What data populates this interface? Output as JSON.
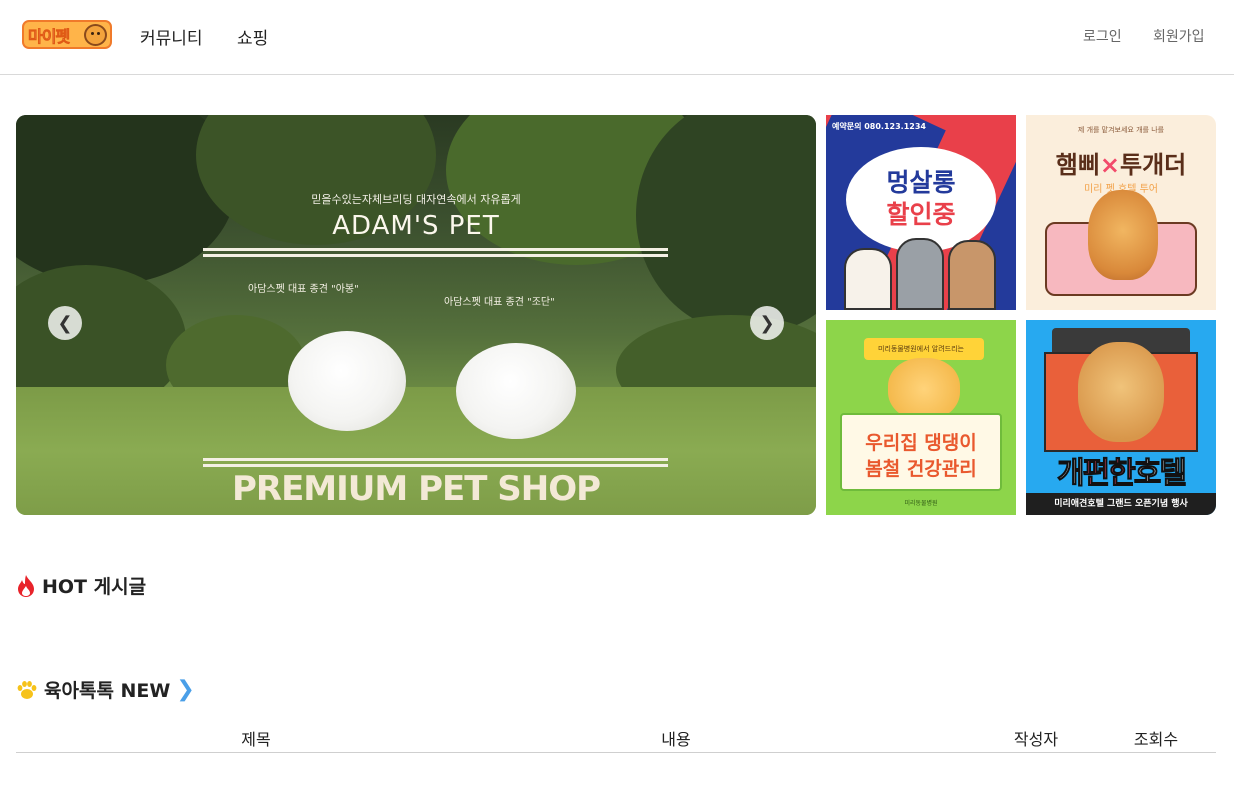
{
  "header": {
    "logo_text": "마이펫",
    "nav": [
      "커뮤니티",
      "쇼핑"
    ],
    "auth": {
      "login": "로그인",
      "signup": "회원가입"
    }
  },
  "hero": {
    "subtitle": "믿을수있는자체브리딩 대자연속에서 자유롭게",
    "brand": "ADAM'S PET",
    "note_left": "아담스펫 대표 종견 \"아봉\"",
    "note_right": "아담스펫 대표 종견 \"조단\"",
    "title": "PREMIUM PET SHOP",
    "prev_icon": "chevron-left-icon",
    "next_icon": "chevron-right-icon"
  },
  "banners": [
    {
      "phone": "예약문의 080.123.1234",
      "line1": "멍살롱",
      "line2": "할인중"
    },
    {
      "sub": "제 개를 맡겨보세요 개를 나를",
      "left": "햄삐",
      "x": "×",
      "right": "투개더",
      "line": "미리 펫 호텔 투어"
    },
    {
      "sub": "미리동물병원에서 알려드리는",
      "line1": "우리집 댕댕이",
      "line2": "봄철 건강관리",
      "foot": "미리동물병원"
    },
    {
      "title_a": "개",
      "title_b": "편한",
      "title_c": "호텔",
      "foot": "미리애견호텔 그랜드 오픈기념 행사"
    }
  ],
  "sections": {
    "hot": {
      "icon": "fire-icon",
      "title": "HOT 게시글"
    },
    "new": {
      "icon": "paw-icon",
      "title": "육아톡톡 NEW",
      "more_icon": "chevron-right-icon"
    }
  },
  "table": {
    "columns": [
      "제목",
      "내용",
      "작성자",
      "조회수"
    ]
  },
  "colors": {
    "accent": "#4a9fe8",
    "hot": "#e8232a",
    "paw": "#f6c21a",
    "logo": "#ffb449"
  }
}
